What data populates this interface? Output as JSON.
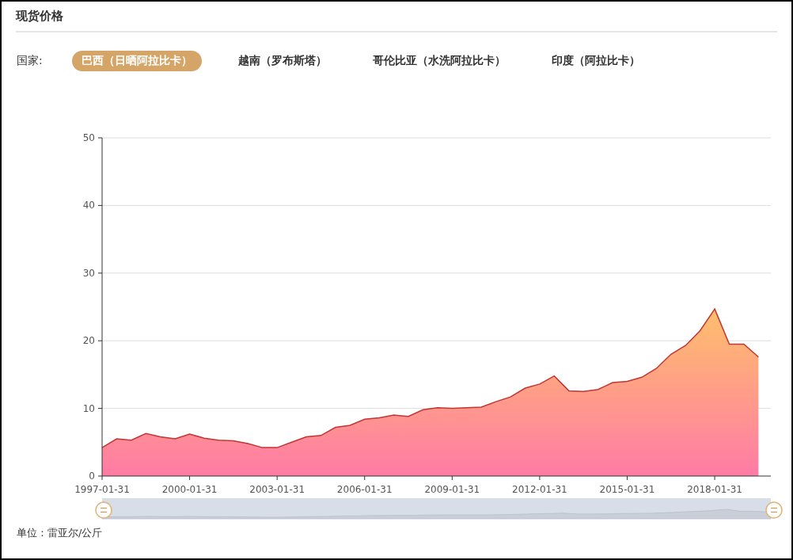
{
  "title": "现货价格",
  "filter": {
    "label": "国家:",
    "options": [
      {
        "label": "巴西（日晒阿拉比卡）",
        "selected": true
      },
      {
        "label": "越南（罗布斯塔）",
        "selected": false
      },
      {
        "label": "哥伦比亚（水洗阿拉比卡）",
        "selected": false
      },
      {
        "label": "印度（阿拉比卡）",
        "selected": false
      }
    ]
  },
  "chart_data": {
    "type": "area",
    "grid": true,
    "ylim": [
      0,
      50
    ],
    "yticks": [
      0,
      10,
      20,
      30,
      40,
      50
    ],
    "categories": [
      "1997-01-31",
      null,
      null,
      null,
      null,
      null,
      "2000-01-31",
      null,
      null,
      null,
      null,
      null,
      "2003-01-31",
      null,
      null,
      null,
      null,
      null,
      "2006-01-31",
      null,
      null,
      null,
      null,
      null,
      "2009-01-31",
      null,
      null,
      null,
      null,
      null,
      "2012-01-31",
      null,
      null,
      null,
      null,
      null,
      "2015-01-31",
      null,
      null,
      null,
      null,
      null,
      "2018-01-31",
      null,
      null,
      null
    ],
    "values": [
      4.2,
      5.5,
      5.3,
      6.3,
      5.8,
      5.5,
      6.2,
      5.6,
      5.3,
      5.2,
      4.8,
      4.2,
      4.2,
      5.0,
      5.8,
      6.0,
      7.2,
      7.5,
      8.4,
      8.6,
      9.0,
      8.8,
      9.8,
      10.1,
      10.0,
      10.1,
      10.2,
      11.0,
      11.7,
      13.0,
      13.6,
      14.8,
      12.6,
      12.5,
      12.8,
      13.8,
      14.0,
      14.6,
      15.9,
      18.0,
      19.3,
      21.5,
      24.7,
      19.5,
      19.5,
      17.6
    ]
  },
  "unit": "单位：雷亚尔/公斤"
}
